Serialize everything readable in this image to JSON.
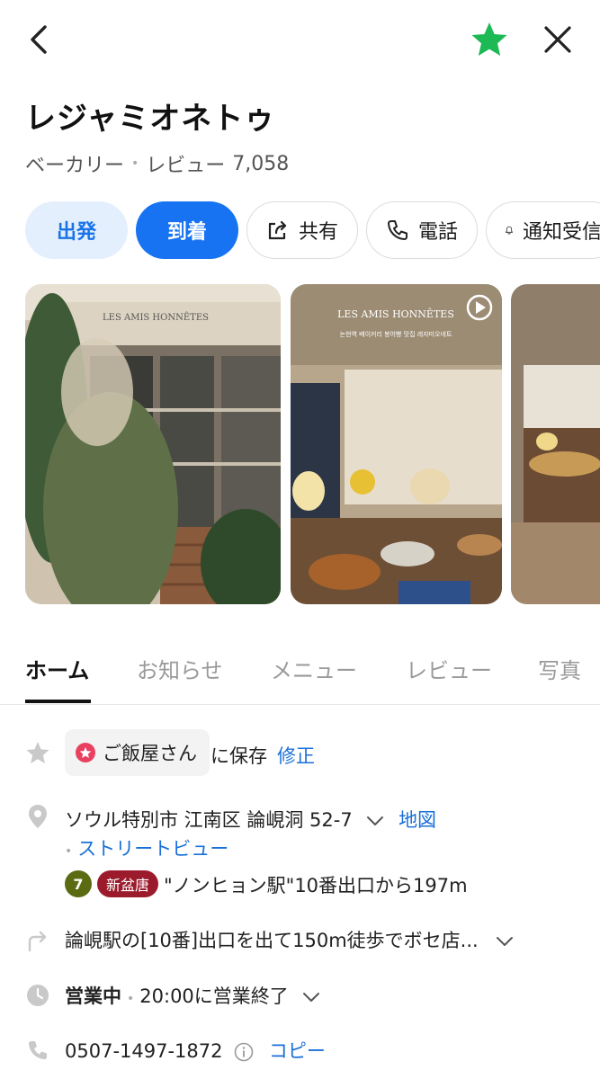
{
  "place": {
    "name": "レジャミオネトゥ",
    "category": "ベーカリー",
    "review_label": "レビュー",
    "review_count": "7,058"
  },
  "actions": {
    "depart": "出発",
    "arrive": "到着",
    "share": "共有",
    "phone": "電話",
    "notify": "通知受信"
  },
  "photos": {
    "photo1_sign": "LES AMIS HONNÊTES",
    "photo2_title": "LES AMIS HONNÊTES",
    "photo2_caption": "논현역 베이커리 붕어빵 맛집 레자미오네트"
  },
  "tabs": [
    "ホーム",
    "お知らせ",
    "メニュー",
    "レビュー",
    "写真"
  ],
  "info": {
    "saved_list": "ご飯屋さん",
    "saved_suffix": "に保存",
    "edit_label": "修正",
    "address": "ソウル特別市 江南区 論峴洞 52-7",
    "map_link": "地図",
    "street_view": "ストリートビュー",
    "subway_line_number": "7",
    "subway_line_badge": "新盆唐",
    "station_directions": "\"ノンヒョン駅\"10番出口から197m",
    "walking_directions": "論峴駅の[10番]出口を出て150m徒歩でボセ店...",
    "hours_status": "営業中",
    "hours_detail": "20:00に営業終了",
    "phone_number": "0507-1497-1872",
    "copy_label": "コピー"
  },
  "colors": {
    "accent_blue": "#1773f1",
    "accent_light": "#e4effd",
    "favorite_green": "#1db954",
    "link_blue": "#1a6fd8",
    "line7": "#5b6b12",
    "line_sinbundang": "#9b1b2c"
  },
  "icons": [
    "back-icon",
    "favorite-star-icon",
    "close-icon",
    "share-icon",
    "phone-icon",
    "bell-icon",
    "play-icon",
    "star-outline-icon",
    "location-pin-icon",
    "turn-arrow-icon",
    "clock-icon",
    "phone-small-icon",
    "info-icon",
    "chevron-down-icon"
  ]
}
